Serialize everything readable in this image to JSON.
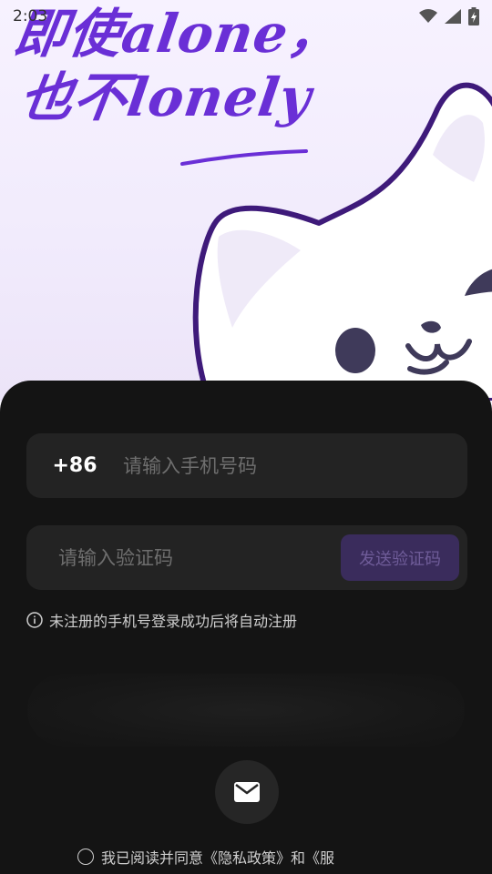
{
  "status_bar": {
    "time": "2:03",
    "wifi_icon": "wifi-icon",
    "signal_icon": "signal-icon",
    "battery_icon": "battery-charging-icon"
  },
  "hero": {
    "headline_line1": "即使alone，",
    "headline_line2": "也不lonely",
    "brand_color": "#6a2fd6",
    "mascot": "cat-mascot"
  },
  "login": {
    "country_code": "+86",
    "phone_placeholder": "请输入手机号码",
    "code_placeholder": "请输入验证码",
    "send_code_label": "发送验证码",
    "notice_text": "未注册的手机号登录成功后将自动注册",
    "mail_icon": "mail-icon",
    "agreement_text": "我已阅读并同意《隐私政策》和《服"
  },
  "colors": {
    "sheet_bg": "#141414",
    "field_bg": "#232323",
    "send_code_bg": "#3a2c5c",
    "send_code_text": "#6f5c99"
  }
}
